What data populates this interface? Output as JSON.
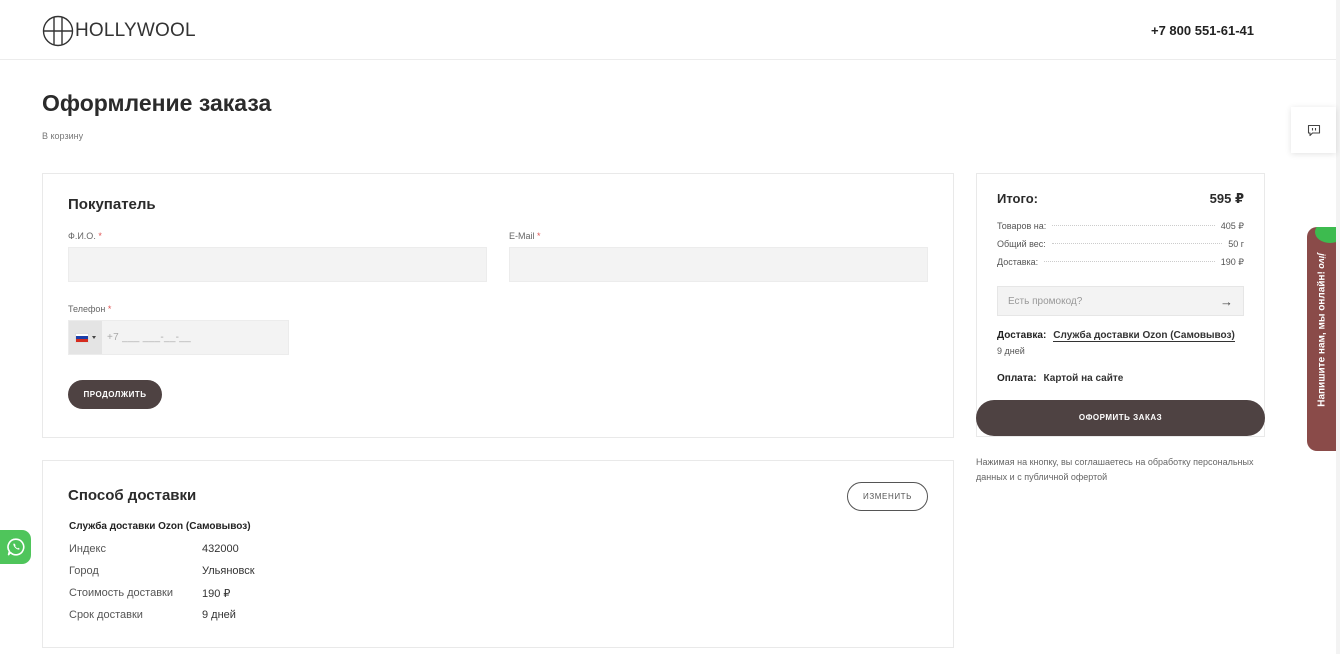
{
  "header": {
    "logo_text": "HOLLYWOOL",
    "phone": "+7 800 551-61-41"
  },
  "page": {
    "title": "Оформление заказа",
    "back_link": "В корзину"
  },
  "buyer": {
    "title": "Покупатель",
    "fio_label": "Ф.И.О.",
    "email_label": "E-Mail",
    "phone_label": "Телефон",
    "required_mark": "*",
    "fio_value": "",
    "email_value": "",
    "phone_mask": "+7 ___ ___-__-__",
    "continue_label": "ПРОДОЛЖИТЬ",
    "country_flag_colors": [
      "#ffffff",
      "#1c3faa",
      "#d52b1e"
    ]
  },
  "delivery": {
    "title": "Способ доставки",
    "change_label": "ИЗМЕНИТЬ",
    "service": "Служба доставки Ozon (Самовывоз)",
    "rows": [
      {
        "key": "Индекс",
        "value": "432000"
      },
      {
        "key": "Город",
        "value": "Ульяновск"
      },
      {
        "key": "Стоимость доставки",
        "value": "190 ₽"
      },
      {
        "key": "Срок доставки",
        "value": "9 дней"
      }
    ]
  },
  "summary": {
    "title": "Итого:",
    "total": "595 ₽",
    "lines": [
      {
        "key": "Товаров на:",
        "value": "405 ₽"
      },
      {
        "key": "Общий вес:",
        "value": "50 г"
      },
      {
        "key": "Доставка:",
        "value": "190 ₽"
      }
    ],
    "promo_placeholder": "Есть промокод?",
    "promo_arrow": "→",
    "delivery_key": "Доставка:",
    "delivery_value": "Служба доставки Ozon (Самовывоз)",
    "delivery_days": "9 дней",
    "payment_key": "Оплата:",
    "payment_value": "Картой на сайте",
    "order_button": "ОФОРМИТЬ ЗАКАЗ"
  },
  "consent_text": "Нажимая на кнопку, вы соглашаетесь на обработку персональных данных и с публичной офертой",
  "widgets": {
    "feedback_icon": "chat-bubble-icon",
    "jivo_logo": "jivo",
    "jivo_text": "Напишите нам, мы онлайн!",
    "whatsapp_icon": "whatsapp-icon",
    "accent_color": "#4e4242",
    "jivo_color": "#8a4b49",
    "whatsapp_color": "#4fc55b"
  }
}
